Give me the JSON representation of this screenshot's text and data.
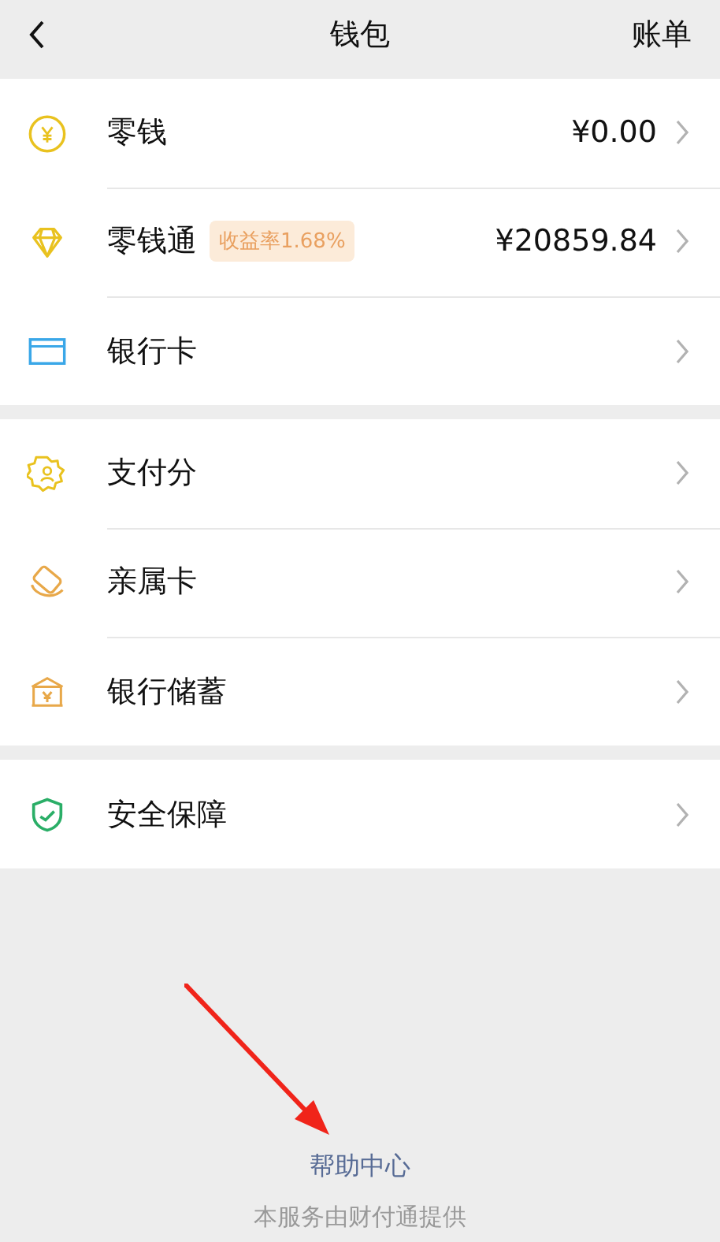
{
  "nav_bar": {
    "title": "钱包",
    "action": "账单"
  },
  "groups": [
    {
      "items": [
        {
          "label": "零钱",
          "value": "¥0.00"
        },
        {
          "label": "零钱通",
          "badge": "收益率1.68%",
          "value": "¥20859.84"
        },
        {
          "label": "银行卡"
        }
      ]
    },
    {
      "items": [
        {
          "label": "支付分"
        },
        {
          "label": "亲属卡"
        },
        {
          "label": "银行储蓄"
        }
      ]
    },
    {
      "items": [
        {
          "label": "安全保障"
        }
      ]
    }
  ],
  "footer": {
    "link": "帮助中心",
    "note": "本服务由财付通提供"
  }
}
